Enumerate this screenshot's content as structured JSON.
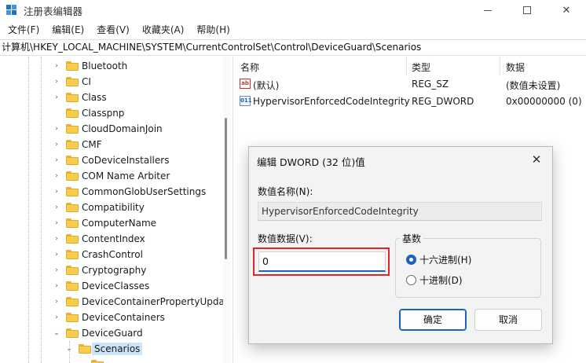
{
  "window": {
    "title": "注册表编辑器",
    "controls": {
      "minimize": "—",
      "close": "✕"
    }
  },
  "menu": [
    "文件(F)",
    "编辑(E)",
    "查看(V)",
    "收藏夹(A)",
    "帮助(H)"
  ],
  "address": "计算机\\HKEY_LOCAL_MACHINE\\SYSTEM\\CurrentControlSet\\Control\\DeviceGuard\\Scenarios",
  "tree": {
    "items": [
      {
        "label": "Bluetooth",
        "expander": "›"
      },
      {
        "label": "CI",
        "expander": "›"
      },
      {
        "label": "Class",
        "expander": "›"
      },
      {
        "label": "Classpnp",
        "expander": ""
      },
      {
        "label": "CloudDomainJoin",
        "expander": "›"
      },
      {
        "label": "CMF",
        "expander": "›"
      },
      {
        "label": "CoDeviceInstallers",
        "expander": "›"
      },
      {
        "label": "COM Name Arbiter",
        "expander": "›"
      },
      {
        "label": "CommonGlobUserSettings",
        "expander": "›"
      },
      {
        "label": "Compatibility",
        "expander": "›"
      },
      {
        "label": "ComputerName",
        "expander": "›"
      },
      {
        "label": "ContentIndex",
        "expander": "›"
      },
      {
        "label": "CrashControl",
        "expander": "›"
      },
      {
        "label": "Cryptography",
        "expander": "›"
      },
      {
        "label": "DeviceClasses",
        "expander": "›"
      },
      {
        "label": "DeviceContainerPropertyUpda",
        "expander": "›"
      },
      {
        "label": "DeviceContainers",
        "expander": "›"
      },
      {
        "label": "DeviceGuard",
        "expander": "⌄"
      },
      {
        "label": "Scenarios",
        "expander": "⌄",
        "selected": true
      }
    ]
  },
  "values": {
    "columns": {
      "name": "名称",
      "type": "类型",
      "data": "数据"
    },
    "rows": [
      {
        "icon": "ab",
        "name": "(默认)",
        "type": "REG_SZ",
        "data": "(数值未设置)"
      },
      {
        "icon": "011",
        "name": "HypervisorEnforcedCodeIntegrity",
        "type": "REG_DWORD",
        "data": "0x00000000 (0)"
      }
    ]
  },
  "dialog": {
    "title": "编辑 DWORD (32 位)值",
    "close": "✕",
    "name_label": "数值名称(N):",
    "name_value": "HypervisorEnforcedCodeIntegrity",
    "data_label": "数值数据(V):",
    "data_value": "0",
    "base_label": "基数",
    "base_options": [
      {
        "label": "十六进制(H)",
        "checked": true
      },
      {
        "label": "十进制(D)",
        "checked": false
      }
    ],
    "ok_label": "确定",
    "cancel_label": "取消"
  }
}
